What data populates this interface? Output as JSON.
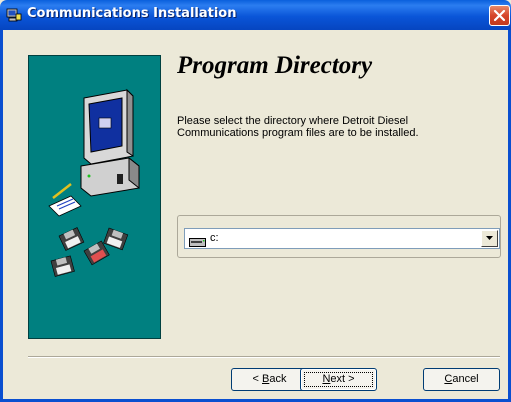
{
  "window": {
    "title": "Communications Installation"
  },
  "page": {
    "heading": "Program Directory",
    "description": "Please select the directory where Detroit Diesel Communications program files are to be installed."
  },
  "drive_select": {
    "value": "c:"
  },
  "buttons": {
    "back_accel": "B",
    "back_rest": "ack",
    "back_prefix": "< ",
    "next_accel": "N",
    "next_rest": "ext >",
    "cancel_accel": "C",
    "cancel_rest": "ancel"
  },
  "colors": {
    "titlebar": "#0a55d8",
    "panel": "#008080",
    "dialog_bg": "#ece9d8"
  }
}
